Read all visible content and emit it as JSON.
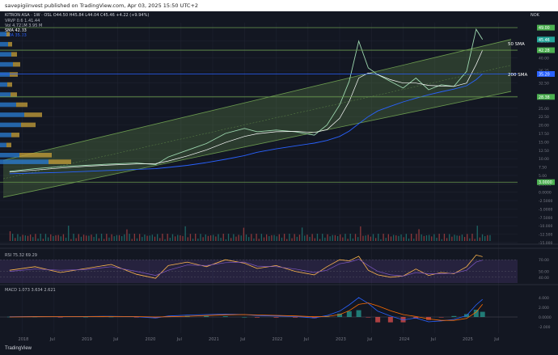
{
  "header": {
    "publish_line": "savepigiinvest published on TradingView.com, Apr 03, 2025 15:50 UTC+2",
    "symbol_line": "KITRON ASA · 1W · OSL  O44.50 H45.84 L44.04 C45.46 +4.22 (+9.94%)",
    "vrvp": "VRVP  0.6  1.41.44",
    "vol": "Vol  4.721M  3.95 M",
    "sma1": "SMA  42.33",
    "sma2": "SMA  35.23",
    "currency": "NOK"
  },
  "colors": {
    "bg": "#131722",
    "up": "#26a69a",
    "down": "#ef5350",
    "channel": "#6a994e",
    "sma50": "#ffffff",
    "sma200": "#2962ff",
    "line": "#2962ff",
    "rsi": "#7e57c2",
    "rsi_line": "#ffb74d",
    "macd": "#2962ff",
    "signal": "#ff6d00",
    "vrvp_up": "#2b7fd6",
    "vrvp_dn": "#c8a23a"
  },
  "annotations": {
    "sma50_label": "50 SMA",
    "sma200_label": "200 SMA"
  },
  "price_badges": [
    "49.00",
    "45.46",
    "42.28",
    "35.20",
    "28.38",
    "3.0000"
  ],
  "rsi_legend": "RSI  75.32  69.29",
  "macd_legend": "MACD  1.073  3.634  2.621",
  "tv_logo": "TradingView",
  "chart_data": [
    {
      "type": "line",
      "name": "Price",
      "x_ticks": [
        "2018",
        "Jul",
        "2019",
        "Jul",
        "2020",
        "Jul",
        "2021",
        "Jul",
        "2022",
        "Jul",
        "2023",
        "Jul",
        "2024",
        "Jul",
        "2025",
        "Jul"
      ],
      "y_ticks": [
        "49.00",
        "45.00",
        "40.00",
        "36.25",
        "32.50",
        "28.75",
        "25.00",
        "22.50",
        "20.00",
        "17.50",
        "15.00",
        "12.50",
        "10.00",
        "7.50",
        "5.00",
        "2.5000",
        "0.0000",
        "-2.5000",
        "-5.0000",
        "-7.5000",
        "-10.000",
        "-12.500",
        "-15.000"
      ],
      "series": [
        {
          "x": [
            2017.8,
            2018.2,
            2018.6,
            2019.0,
            2019.4,
            2019.8,
            2020.1,
            2020.3,
            2020.6,
            2020.9,
            2021.2,
            2021.5,
            2021.7,
            2022.0,
            2022.3,
            2022.6,
            2022.8,
            2023.0,
            2023.15,
            2023.3,
            2023.45,
            2023.6,
            2023.8,
            2024.0,
            2024.2,
            2024.4,
            2024.6,
            2024.8,
            2025.0,
            2025.15,
            2025.25
          ],
          "values": [
            6.2,
            7.0,
            7.6,
            8.0,
            8.4,
            8.7,
            8.2,
            10.5,
            12.5,
            14.5,
            17.5,
            19.0,
            18.0,
            18.5,
            18.0,
            17.0,
            20.0,
            26.0,
            33.0,
            45.0,
            37.0,
            35.0,
            33.0,
            31.0,
            34.0,
            30.5,
            32.0,
            31.5,
            36.0,
            48.5,
            45.46
          ]
        }
      ],
      "sma50": [
        6.0,
        6.6,
        7.2,
        7.7,
        8.1,
        8.4,
        8.5,
        9.3,
        10.8,
        12.6,
        14.8,
        16.6,
        17.4,
        18.0,
        18.1,
        17.8,
        18.6,
        22.0,
        27.0,
        34.0,
        35.5,
        35.0,
        33.5,
        32.5,
        32.5,
        31.8,
        31.6,
        31.5,
        32.5,
        38.0,
        42.33
      ],
      "sma200": [
        5.5,
        5.7,
        5.9,
        6.2,
        6.5,
        6.8,
        7.0,
        7.4,
        8.0,
        8.8,
        9.8,
        10.9,
        11.9,
        12.9,
        13.8,
        14.6,
        15.4,
        16.6,
        18.2,
        20.4,
        22.5,
        24.2,
        25.6,
        26.9,
        28.0,
        29.0,
        29.9,
        30.7,
        31.7,
        33.5,
        35.23
      ]
    },
    {
      "type": "line",
      "name": "RSI",
      "y_ticks": [
        "70.00",
        "50.00",
        "40.00"
      ],
      "values": [
        52,
        58,
        48,
        55,
        62,
        45,
        38,
        60,
        66,
        58,
        70,
        64,
        55,
        60,
        50,
        44,
        58,
        70,
        68,
        76,
        52,
        44,
        40,
        42,
        54,
        43,
        48,
        46,
        58,
        78,
        75.32
      ],
      "signal": [
        50,
        54,
        52,
        53,
        58,
        50,
        43,
        52,
        61,
        60,
        65,
        66,
        59,
        58,
        54,
        48,
        52,
        63,
        66,
        71,
        60,
        50,
        44,
        42,
        48,
        46,
        46,
        47,
        52,
        66,
        69.29
      ]
    },
    {
      "type": "bar",
      "name": "MACD",
      "y_ticks": [
        "4.000",
        "2.000",
        "0.0000",
        "-2.000"
      ],
      "values": [
        0.05,
        0.1,
        0.05,
        0.1,
        0.15,
        0.05,
        -0.2,
        0.2,
        0.4,
        0.5,
        0.6,
        0.5,
        0.3,
        0.2,
        0.1,
        -0.2,
        0.3,
        1.2,
        2.5,
        4.0,
        2.8,
        1.2,
        0.2,
        -0.6,
        -0.2,
        -1.0,
        -0.8,
        -0.5,
        0.3,
        2.5,
        3.634
      ],
      "signal": [
        0.0,
        0.05,
        0.07,
        0.08,
        0.1,
        0.09,
        0.0,
        0.05,
        0.15,
        0.3,
        0.45,
        0.5,
        0.42,
        0.33,
        0.22,
        0.05,
        0.1,
        0.5,
        1.3,
        2.6,
        2.9,
        2.3,
        1.3,
        0.5,
        0.1,
        -0.4,
        -0.7,
        -0.7,
        -0.3,
        1.0,
        2.621
      ],
      "histogram": [
        0.05,
        0.05,
        -0.02,
        0.02,
        0.05,
        -0.04,
        -0.2,
        0.15,
        0.25,
        0.2,
        0.15,
        0.0,
        -0.12,
        -0.13,
        -0.12,
        -0.25,
        0.2,
        0.7,
        1.2,
        1.4,
        -0.1,
        -1.1,
        -1.1,
        -1.1,
        -0.3,
        -0.6,
        -0.1,
        0.2,
        0.6,
        1.5,
        1.073
      ]
    }
  ]
}
